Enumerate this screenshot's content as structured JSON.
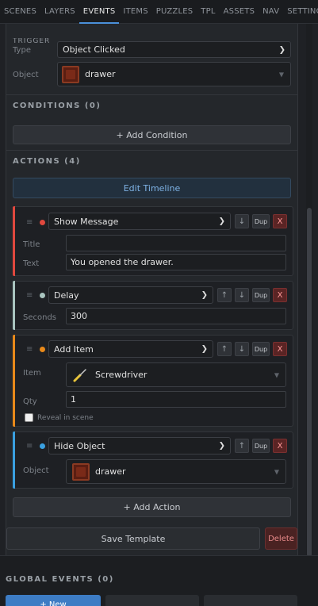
{
  "tabs": [
    {
      "label": "SCENES",
      "active": false
    },
    {
      "label": "LAYERS",
      "active": false
    },
    {
      "label": "EVENTS",
      "active": true
    },
    {
      "label": "ITEMS",
      "active": false
    },
    {
      "label": "PUZZLES",
      "active": false
    },
    {
      "label": "TPL",
      "active": false
    },
    {
      "label": "ASSETS",
      "active": false
    },
    {
      "label": "NAV",
      "active": false
    },
    {
      "label": "SETTINGS",
      "active": false
    }
  ],
  "trigger": {
    "header": "TRIGGER",
    "type_label": "Type",
    "type_value": "Object Clicked",
    "object_label": "Object",
    "object_value": "drawer"
  },
  "conditions": {
    "header": "CONDITIONS (0)",
    "add_label": "+ Add Condition"
  },
  "actions": {
    "header": "ACTIONS (4)",
    "edit_timeline_label": "Edit Timeline",
    "add_label": "+ Add Action",
    "dup_label": "Dup",
    "x_label": "X",
    "up_glyph": "↑",
    "down_glyph": "↓",
    "drag_glyph": "≡",
    "items": [
      {
        "type": "Show Message",
        "color": "#e0483e",
        "fields": [
          {
            "label": "Title",
            "value": ""
          },
          {
            "label": "Text",
            "value": "You opened the drawer."
          }
        ]
      },
      {
        "type": "Delay",
        "color": "#a9c4bf",
        "fields": [
          {
            "label": "Seconds",
            "value": "300"
          }
        ]
      },
      {
        "type": "Add Item",
        "color": "#e8891a",
        "item_label": "Item",
        "item_value": "Screwdriver",
        "qty_label": "Qty",
        "qty_value": "1",
        "reveal_label": "Reveal in scene"
      },
      {
        "type": "Hide Object",
        "color": "#3aa0e0",
        "object_label": "Object",
        "object_value": "drawer"
      }
    ]
  },
  "footer": {
    "save_template_label": "Save Template",
    "delete_label": "Delete"
  },
  "global_events": {
    "header": "GLOBAL EVENTS (0)",
    "new_label": "+ New"
  }
}
